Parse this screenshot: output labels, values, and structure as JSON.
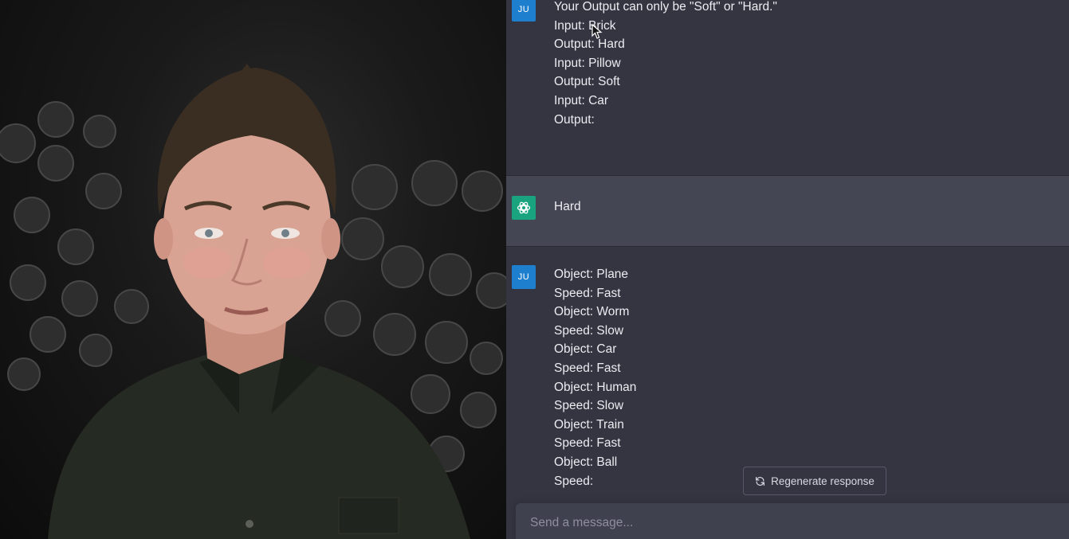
{
  "messages": [
    {
      "role": "user",
      "avatar": "JU",
      "lines": [
        "Your Output can only be \"Soft\" or \"Hard.\"",
        "",
        "Input: Brick",
        "Output: Hard",
        "Input: Pillow",
        "Output: Soft",
        "Input: Car",
        "Output:"
      ]
    },
    {
      "role": "assistant",
      "avatar_icon": "openai-logo-icon",
      "lines": [
        "Hard"
      ]
    },
    {
      "role": "user",
      "avatar": "JU",
      "lines": [
        "Object: Plane",
        "Speed: Fast",
        "Object: Worm",
        "Speed: Slow",
        "Object: Car",
        "Speed: Fast",
        "Object: Human",
        "Speed: Slow",
        "Object: Train",
        "Speed: Fast",
        "Object: Ball",
        "Speed:"
      ]
    }
  ],
  "regenerate": {
    "label": "Regenerate response",
    "icon": "refresh-icon"
  },
  "composer": {
    "placeholder": "Send a message...",
    "value": ""
  },
  "colors": {
    "chat_bg": "#343541",
    "assistant_bg": "#444654",
    "user_avatar": "#1e7fcf",
    "gpt_avatar": "#19a37f",
    "composer_bg": "#40414f"
  }
}
